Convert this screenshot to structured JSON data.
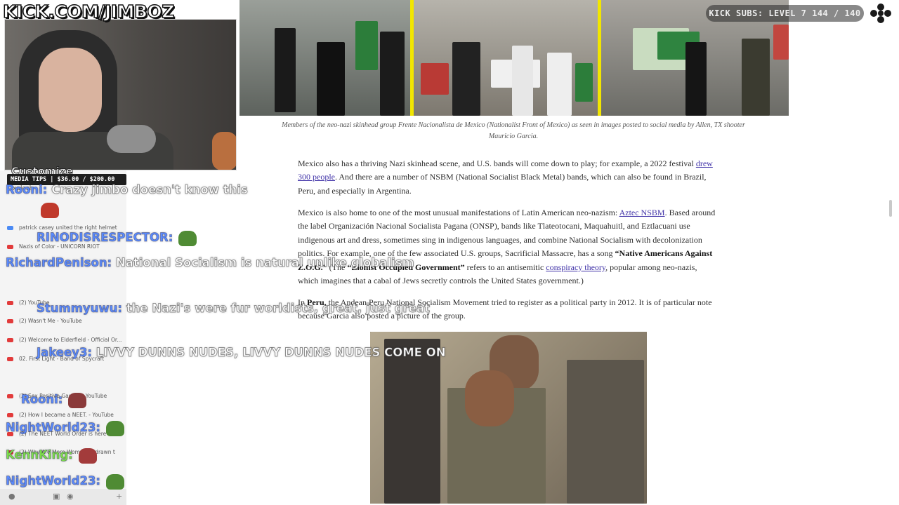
{
  "overlay": {
    "stream_url": "KICK.COM/JIMBOZ",
    "subs_text": "KICK SUBS: LEVEL 7 144 / 140",
    "media_tips": "MEDIA TIPS | $36.00 / $200.00",
    "customize_label": "Customize"
  },
  "article": {
    "caption": "Members of the neo-nazi skinhead group Frente Nacionalista de Mexico (Nationalist Front of Mexico) as seen in images posted to social media by Allen, TX shooter Mauricio Garcia.",
    "p1": {
      "text_a": "Mexico also has a thriving Nazi skinhead scene, and U.S. bands will come down to play; for example, a 2022 festival ",
      "link": "drew 300 people",
      "text_b": ". And there are a number of NSBM (National Socialist Black Metal) bands, which can also be found in Brazil, Peru, and especially in Argentina."
    },
    "p2": {
      "text_a": "Mexico is also home to one of the most unusual manifestations of Latin American neo-nazism: ",
      "link1": "Aztec NSBM",
      "text_b": ". Based around the label Organización Nacional Socialista Pagana (ONSP), bands like Tlateotocani, Maquahuitl, and Eztlacuani use indigenous art and dress, sometimes sing in indigenous languages, and combine National Socialism with decolonization politics. For example, one of the few associated U.S. groups, Sacrificial Massacre, has a song ",
      "bold1": "“Native Americans Against Z.O.G.”",
      "text_c": " (The ",
      "bold2": "“Zionist Occupied Government”",
      "text_d": " refers to an antisemitic ",
      "link2": "conspiracy theory",
      "text_e": ", popular among neo-nazis, which imagines that a cabal of Jews secretly controls the United States government.)"
    },
    "p3": {
      "text_a": "In ",
      "bold": "Peru,",
      "text_b": " the Andean Peru National Socialism Movement tried to register as a political party in 2012. It is of particular note because Garcia also posted a picture of the group."
    }
  },
  "chat": {
    "yt_lines": [
      "patrick casey united the right helmet",
      "Nazis of Color - UNICORN RIOT",
      "(2) YouTube",
      "(2) Wasn't Me - YouTube",
      "(2) Welcome to Elderfield - Official Or...",
      "02. First Light - Band of Spycraft",
      "(2) Sex Positive Gami... - YouTube",
      "(2) How I became a NEET. - YouTube",
      "(2) The NEET World Order is here -",
      "(2) Why Are More Women ... drawn t"
    ],
    "messages": [
      {
        "user": "Rooni:",
        "text": "Crazy jimbo doesn't know this",
        "color": "blue"
      },
      {
        "user": "RINODISRESPECTOR:",
        "text": "",
        "color": "blue"
      },
      {
        "user": "RichardPenison:",
        "text": "National Socialism is natural unlike globalism",
        "color": "blue"
      },
      {
        "user": "Stummyuwu:",
        "text": "the Nazi's were fur worldists, great, just great",
        "color": "blue"
      },
      {
        "user": "Jakeey3:",
        "text": "LIVVY DUNNS NUDES, LIVVY DUNNS NUDES COME ON",
        "color": "blue"
      },
      {
        "user": "Rooni:",
        "text": "",
        "color": "blue"
      },
      {
        "user": "NightWorld23:",
        "text": "",
        "color": "blue"
      },
      {
        "user": "KennKing:",
        "text": "",
        "color": "green"
      },
      {
        "user": "NightWorld23:",
        "text": "",
        "color": "blue"
      }
    ],
    "xplosh": "xplosh"
  },
  "colors": {
    "link": "#4133a8",
    "divider_yellow": "#f2e600",
    "chat_user_blue": "#5b8cff",
    "chat_user_green": "#7fe34a"
  }
}
